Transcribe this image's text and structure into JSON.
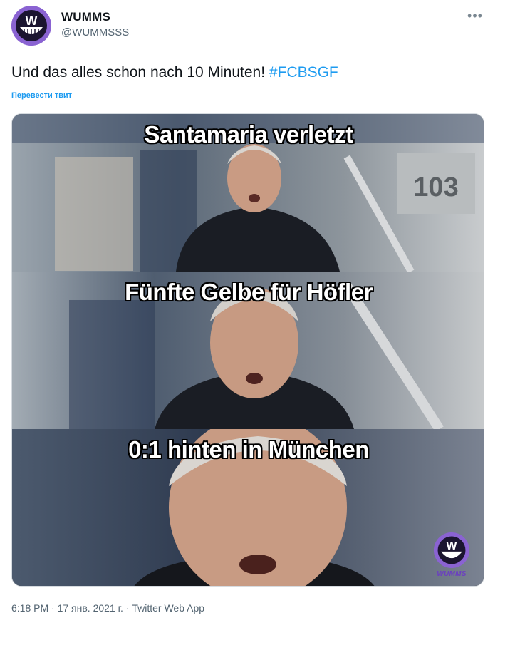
{
  "account": {
    "display_name": "WUMMS",
    "handle": "@WUMMSSS",
    "avatar_icon": "wumms-grin-logo"
  },
  "tweet": {
    "text": "Und das alles schon nach 10 Minuten! ",
    "hashtag": "#FCBSGF",
    "translate_label": "Перевести твит",
    "more_icon": "more-dots-icon"
  },
  "meme": {
    "panels": [
      {
        "caption": "Santamaria verletzt"
      },
      {
        "caption": "Fünfte Gelbe für Höfler"
      },
      {
        "caption": "0:1 hinten in München"
      }
    ],
    "watermark": "WUMMS",
    "stadium_sign": "103"
  },
  "meta": {
    "timestamp": "6:18 PM · 17 янв. 2021 г. · Twitter Web App"
  },
  "colors": {
    "link": "#1d9bf0",
    "brand_purple": "#8a63d2",
    "secondary_text": "#536471"
  }
}
